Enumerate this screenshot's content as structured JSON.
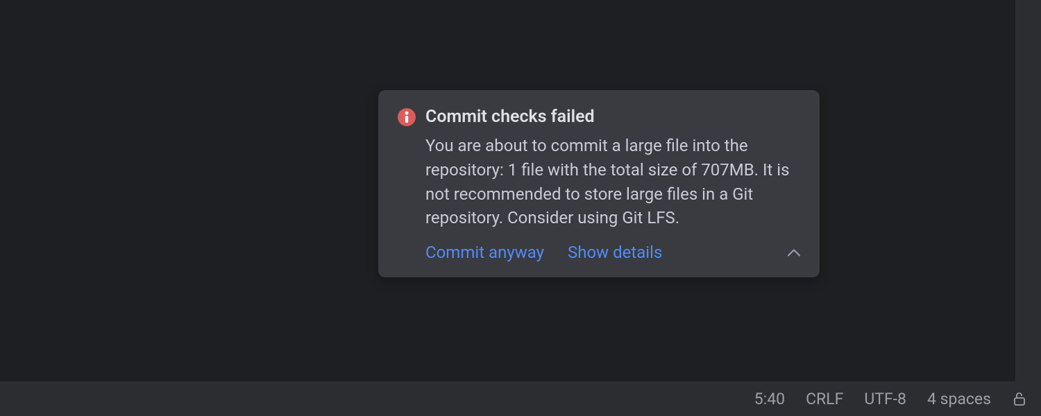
{
  "notification": {
    "title": "Commit checks failed",
    "body": "You are about to commit a large file into the repository: 1 file with the total size of 707MB. It is not recommended to store large files in a Git repository. Consider using Git LFS.",
    "actions": {
      "primary": "Commit anyway",
      "secondary": "Show details"
    }
  },
  "statusBar": {
    "position": "5:40",
    "lineSeparator": "CRLF",
    "encoding": "UTF-8",
    "indent": "4 spaces"
  }
}
